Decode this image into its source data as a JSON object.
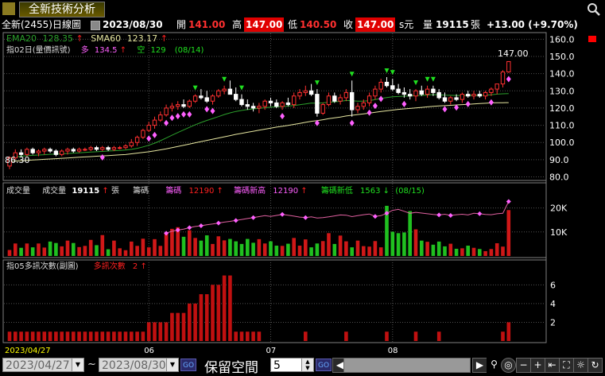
{
  "header": {
    "title": "全新技術分析",
    "stock": "全新(2455)",
    "period": "日線圖",
    "date": "2023/08/30",
    "open_label": "開",
    "open": "141.00",
    "high_label": "高",
    "high": "147.00",
    "low_label": "低",
    "low": "140.50",
    "close_label": "收",
    "close": "147.00",
    "currency": "s元",
    "vol_label": "量",
    "volume": "19115",
    "unit": "張",
    "change": "+13.00 (+9.70%)"
  },
  "colors": {
    "up": "#ff2020",
    "down": "#20e020",
    "ema": "#2ca02c",
    "sma": "#e6e6a0",
    "cost": "#ff80ff",
    "grid": "#505050",
    "accent": "#ffff00"
  },
  "price_panel": {
    "ema_label": "EMA20",
    "ema_value": "128.35",
    "sma_label": "SMA60",
    "sma_value": "123.17",
    "signal_label": "指02日(量價訊號)",
    "long_label": "多",
    "long_value": "134.5",
    "short_label": "空",
    "short_value": "129",
    "signal_date": "(08/14)",
    "last_label": "147.00",
    "low_label": "86.30"
  },
  "volume_panel": {
    "title": "成交量",
    "vol_label": "成交量",
    "vol_value": "19115",
    "unit": "張",
    "chip_label": "籌碼",
    "chip_qty_label": "籌碼",
    "chip_qty_value": "12190",
    "chip_high_label": "籌碼新高",
    "chip_high_value": "12190",
    "chip_low_label": "籌碼新低",
    "chip_low_value": "1563",
    "chip_date": "(08/15)"
  },
  "count_panel": {
    "title": "指05多訊次數(副圖)",
    "count_label": "多訊次數",
    "count_value": "2"
  },
  "chart_data": {
    "type": "candlestick",
    "price_axis": {
      "ticks": [
        80,
        90,
        100,
        110,
        120,
        130,
        140,
        150,
        160
      ],
      "range": [
        77,
        162
      ]
    },
    "volume_axis": {
      "ticks": [
        "10K",
        "20K"
      ],
      "tick_values": [
        10000,
        20000
      ],
      "range": [
        0,
        26500
      ]
    },
    "count_axis": {
      "ticks": [
        2,
        4,
        6
      ],
      "range": [
        0,
        7.3
      ]
    },
    "x_labels": [
      {
        "label": "2023/04/27",
        "index": 0
      },
      {
        "label": "06",
        "index": 24
      },
      {
        "label": "07",
        "index": 45
      },
      {
        "label": "08",
        "index": 66
      }
    ],
    "candles": [
      [
        86.3,
        92,
        84.5,
        91
      ],
      [
        91,
        96,
        90,
        94
      ],
      [
        94,
        96,
        92,
        93
      ],
      [
        93,
        97,
        92,
        96
      ],
      [
        96,
        97,
        93,
        94
      ],
      [
        94,
        96,
        92,
        95
      ],
      [
        95,
        97,
        93,
        96
      ],
      [
        96,
        97,
        94,
        95
      ],
      [
        95,
        96,
        92,
        93
      ],
      [
        93,
        96,
        92,
        95
      ],
      [
        95,
        97,
        93,
        96
      ],
      [
        96,
        97,
        94,
        95
      ],
      [
        95,
        97,
        94,
        96
      ],
      [
        96,
        97,
        95,
        96
      ],
      [
        96,
        98,
        95,
        97
      ],
      [
        97,
        98,
        95,
        96
      ],
      [
        96,
        98,
        95,
        97
      ],
      [
        97,
        98,
        95,
        96
      ],
      [
        96,
        98,
        95,
        97
      ],
      [
        97,
        98,
        96,
        97
      ],
      [
        97,
        99,
        96,
        98
      ],
      [
        98,
        102,
        97,
        100
      ],
      [
        100,
        104,
        98,
        103
      ],
      [
        103,
        108,
        102,
        107
      ],
      [
        107,
        112,
        106,
        110
      ],
      [
        110,
        115,
        108,
        113
      ],
      [
        113,
        118,
        112,
        116
      ],
      [
        116,
        122,
        115,
        120
      ],
      [
        120,
        123,
        118,
        121
      ],
      [
        121,
        124,
        119,
        122
      ],
      [
        122,
        125,
        120,
        121
      ],
      [
        121,
        125,
        120,
        124
      ],
      [
        124,
        128,
        123,
        127
      ],
      [
        127,
        131,
        125,
        126
      ],
      [
        126,
        130,
        123,
        124
      ],
      [
        124,
        128,
        122,
        127
      ],
      [
        127,
        131,
        126,
        130
      ],
      [
        130,
        133,
        128,
        131
      ],
      [
        131,
        136,
        130,
        128
      ],
      [
        128,
        132,
        124,
        125
      ],
      [
        125,
        128,
        121,
        122
      ],
      [
        122,
        125,
        119,
        121
      ],
      [
        121,
        123,
        118,
        120
      ],
      [
        120,
        123,
        117,
        121
      ],
      [
        121,
        125,
        119,
        124
      ],
      [
        124,
        126,
        121,
        123
      ],
      [
        123,
        125,
        120,
        121
      ],
      [
        121,
        124,
        119,
        123
      ],
      [
        123,
        126,
        121,
        122
      ],
      [
        122,
        129,
        120,
        127
      ],
      [
        127,
        131,
        125,
        129
      ],
      [
        129,
        133,
        127,
        130
      ],
      [
        130,
        134,
        127,
        128
      ],
      [
        128,
        131,
        115,
        117
      ],
      [
        117,
        123,
        116,
        122
      ],
      [
        122,
        129,
        121,
        127
      ],
      [
        127,
        129,
        123,
        124
      ],
      [
        124,
        128,
        122,
        126
      ],
      [
        126,
        131,
        124,
        129
      ],
      [
        129,
        136,
        115,
        119
      ],
      [
        119,
        123,
        117,
        121
      ],
      [
        121,
        125,
        119,
        123
      ],
      [
        123,
        129,
        121,
        127
      ],
      [
        127,
        133,
        125,
        131
      ],
      [
        131,
        137,
        129,
        135
      ],
      [
        135,
        138,
        132,
        133
      ],
      [
        133,
        137,
        130,
        131
      ],
      [
        131,
        134,
        128,
        129
      ],
      [
        129,
        132,
        126,
        128
      ],
      [
        128,
        131,
        125,
        127
      ],
      [
        127,
        131,
        124,
        130
      ],
      [
        130,
        133,
        127,
        128
      ],
      [
        128,
        133,
        126,
        131
      ],
      [
        131,
        133,
        127,
        129
      ],
      [
        129,
        131,
        125,
        126
      ],
      [
        126,
        129,
        123,
        124
      ],
      [
        124,
        127,
        122,
        126
      ],
      [
        126,
        128,
        124,
        125
      ],
      [
        125,
        129,
        123,
        128
      ],
      [
        128,
        130,
        126,
        127
      ],
      [
        127,
        130,
        125,
        128
      ],
      [
        128,
        130,
        126,
        127
      ],
      [
        127,
        130,
        125,
        129
      ],
      [
        129,
        132,
        127,
        131
      ],
      [
        131,
        134,
        128,
        134
      ],
      [
        134,
        142,
        132,
        141
      ],
      [
        141,
        147,
        140.5,
        147
      ]
    ],
    "ema20": [
      91,
      91.5,
      92,
      92.3,
      92.5,
      92.7,
      92.9,
      93.1,
      93.2,
      93.4,
      93.6,
      93.8,
      94,
      94.2,
      94.4,
      94.6,
      94.8,
      95,
      95.2,
      95.4,
      95.6,
      96,
      96.6,
      97.4,
      98.4,
      99.6,
      101,
      102.6,
      104.2,
      105.8,
      107.3,
      108.8,
      110.3,
      111.6,
      112.8,
      113.9,
      115,
      116.2,
      117.2,
      118,
      118.6,
      119.1,
      119.5,
      119.8,
      120.2,
      120.5,
      120.7,
      120.9,
      121.1,
      121.5,
      121.9,
      122.4,
      122.9,
      122.8,
      123,
      123.4,
      123.6,
      123.9,
      124.4,
      124.2,
      124,
      124,
      124.3,
      124.9,
      125.6,
      126.1,
      126.5,
      126.7,
      126.9,
      127,
      127.2,
      127.3,
      127.6,
      127.8,
      127.7,
      127.5,
      127.4,
      127.3,
      127.3,
      127.3,
      127.3,
      127.3,
      127.5,
      127.7,
      128.1,
      128.3,
      128.35
    ],
    "sma60": [
      89,
      89.2,
      89.4,
      89.6,
      89.8,
      90,
      90.2,
      90.4,
      90.6,
      90.8,
      91,
      91.2,
      91.4,
      91.6,
      91.8,
      92,
      92.2,
      92.4,
      92.6,
      92.8,
      93,
      93.4,
      93.8,
      94.2,
      94.6,
      95.1,
      95.7,
      96.3,
      97,
      97.7,
      98.4,
      99.1,
      99.8,
      100.5,
      101.2,
      101.9,
      102.6,
      103.3,
      104,
      104.7,
      105.3,
      105.9,
      106.5,
      107.1,
      107.7,
      108.3,
      108.9,
      109.4,
      109.9,
      110.5,
      111.1,
      111.7,
      112.3,
      112.7,
      113.2,
      113.8,
      114.3,
      114.8,
      115.4,
      115.8,
      116.2,
      116.6,
      117,
      117.5,
      118,
      118.4,
      118.8,
      119.2,
      119.5,
      119.8,
      120.1,
      120.4,
      120.7,
      121,
      121.2,
      121.4,
      121.6,
      121.8,
      122,
      122.2,
      122.4,
      122.6,
      122.8,
      123,
      123.05,
      123.1,
      123.17
    ],
    "volumes": [
      2500,
      5200,
      3400,
      5200,
      3600,
      5200,
      3500,
      6000,
      5400,
      4000,
      6400,
      5400,
      3700,
      4200,
      6700,
      4500,
      8700,
      2800,
      6400,
      3200,
      2400,
      6000,
      4200,
      7200,
      3600,
      7000,
      4200,
      9500,
      11300,
      12000,
      8000,
      10700,
      7500,
      6400,
      8600,
      5000,
      8200,
      6500,
      7100,
      6100,
      5000,
      7100,
      5500,
      7000,
      5200,
      6100,
      4300,
      4200,
      5100,
      7500,
      4300,
      6900,
      3600,
      5200,
      6200,
      9500,
      5000,
      8500,
      6100,
      3600,
      6400,
      4100,
      3900,
      6200,
      3600,
      20900,
      10100,
      9500,
      9800,
      18700,
      11100,
      6400,
      5900,
      4700,
      6000,
      4000,
      5100,
      3000,
      3200,
      4300,
      3400,
      2900,
      2000,
      2900,
      5300,
      3900,
      19115
    ],
    "chip_line": [
      null,
      null,
      null,
      null,
      null,
      null,
      null,
      null,
      null,
      null,
      null,
      null,
      null,
      null,
      null,
      null,
      null,
      null,
      null,
      null,
      null,
      null,
      null,
      null,
      null,
      null,
      null,
      9500,
      10300,
      10800,
      11200,
      11800,
      12300,
      12600,
      13000,
      13300,
      13700,
      14100,
      14400,
      14800,
      15200,
      15600,
      16000,
      16400,
      16800,
      16500,
      16900,
      17300,
      17000,
      16600,
      16200,
      16000,
      16300,
      15800,
      16000,
      16300,
      16700,
      17100,
      17000,
      16400,
      16800,
      17200,
      17500,
      16500,
      16800,
      17800,
      19000,
      19400,
      18600,
      17800,
      18200,
      17900,
      17600,
      17300,
      17100,
      17400,
      16900,
      17200,
      17400,
      17100,
      17800,
      17600,
      17300,
      17200,
      17600,
      17800,
      22700
    ],
    "chip_markers": [
      27,
      29,
      31,
      33,
      36,
      39,
      42,
      47,
      51,
      63,
      65,
      74,
      76,
      81,
      86
    ],
    "counts": [
      1,
      1,
      1,
      1,
      1,
      1,
      1,
      1,
      1,
      1,
      1,
      1,
      1,
      1,
      1,
      1,
      1,
      1,
      1,
      1,
      1,
      1,
      1,
      1,
      2,
      2,
      2,
      2,
      3,
      3,
      3,
      4,
      4,
      5,
      5,
      6,
      6,
      7,
      7,
      1,
      1,
      1,
      1,
      1,
      0,
      0,
      0,
      0,
      0,
      0,
      0,
      0,
      0,
      0,
      0,
      0,
      0,
      0,
      0,
      0,
      0,
      0,
      0,
      0,
      0,
      0,
      0,
      0,
      0,
      0,
      0,
      0,
      0,
      0,
      0,
      0,
      0,
      0,
      0,
      0,
      0,
      0,
      0,
      0,
      0,
      0,
      1
    ],
    "count_late": [
      [
        51,
        1
      ],
      [
        58,
        1
      ],
      [
        65,
        1
      ],
      [
        70,
        1
      ],
      [
        74,
        1
      ],
      [
        85,
        1
      ],
      [
        86,
        2
      ]
    ],
    "up_signals": [
      16,
      24,
      25,
      27,
      28,
      29,
      30,
      31,
      34,
      35,
      47,
      53,
      59,
      62,
      63,
      64,
      68,
      75,
      77,
      79,
      83,
      86
    ],
    "down_signals": [
      32,
      37,
      40,
      53,
      59,
      65,
      66,
      70,
      72,
      73
    ]
  },
  "footer": {
    "start_date": "2023/04/27",
    "end_date": "2023/08/30",
    "tilde": "~",
    "go_label": "GO",
    "space_label": "保留空間",
    "space_value": "5"
  }
}
